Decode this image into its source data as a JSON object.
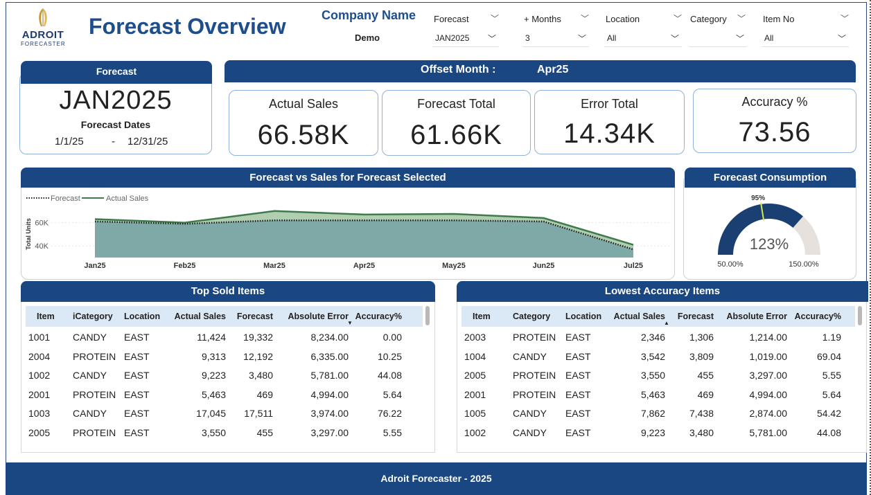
{
  "header": {
    "logo_text": "ADROIT",
    "logo_sub": "FORECASTER",
    "title": "Forecast Overview",
    "company_label": "Company Name",
    "company_value": "Demo"
  },
  "filters": [
    {
      "label": "Forecast",
      "value": "JAN2025"
    },
    {
      "label": "+ Months",
      "value": "3"
    },
    {
      "label": "Location",
      "value": "All"
    },
    {
      "label": "Category",
      "value": ""
    },
    {
      "label": "Item No",
      "value": "All"
    }
  ],
  "forecast_panel": {
    "title": "Forecast",
    "value": "JAN2025",
    "dates_label": "Forecast Dates",
    "start": "1/1/25",
    "sep": "-",
    "end": "12/31/25"
  },
  "offset": {
    "label": "Offset  Month :",
    "value": "Apr25"
  },
  "kpis": [
    {
      "title": "Actual Sales",
      "value": "66.58K"
    },
    {
      "title": "Forecast Total",
      "value": "61.66K"
    },
    {
      "title": "Error Total",
      "value": "14.34K"
    },
    {
      "title": "Accuracy %",
      "value": "73.56"
    }
  ],
  "chart_panel": {
    "title": "Forecast vs Sales for Forecast Selected"
  },
  "chart_data": {
    "type": "area",
    "x": [
      "Jan25",
      "Feb25",
      "Mar25",
      "Apr25",
      "May25",
      "Jun25",
      "Jul25"
    ],
    "series": [
      {
        "name": "Forecast",
        "values": [
          61000,
          59000,
          62000,
          62000,
          62000,
          61000,
          37000
        ]
      },
      {
        "name": "Actual Sales",
        "values": [
          63000,
          60000,
          70000,
          67000,
          67500,
          64000,
          41000
        ]
      }
    ],
    "ylabel": "Total Units",
    "yticks": [
      "40K",
      "60K"
    ],
    "ylim": [
      30000,
      80000
    ],
    "legend": "top-left",
    "colors": {
      "forecast": "#1a1a1a",
      "actual": "#3f7a4c",
      "fill": "#7fa9a6"
    }
  },
  "gauge": {
    "title": "Forecast Consumption",
    "target_label": "95%",
    "value_label": "123%",
    "min_label": "50.00%",
    "max_label": "150.00%",
    "min": 50,
    "max": 150,
    "value": 123,
    "target": 95,
    "colors": {
      "fill": "#1a3f73",
      "rest": "#e6e1dc",
      "target": "#d9e84a"
    }
  },
  "top_sold": {
    "title": "Top Sold Items",
    "columns": [
      "Item",
      "iCategory",
      "Location",
      "Actual Sales",
      "Forecast",
      "Absolute Error",
      "Accuracy%"
    ],
    "rows": [
      [
        "1001",
        "CANDY",
        "EAST",
        "11,424",
        "19,332",
        "8,234.00",
        "0.00"
      ],
      [
        "2004",
        "PROTEIN",
        "EAST",
        "9,313",
        "12,192",
        "6,335.00",
        "10.25"
      ],
      [
        "1002",
        "CANDY",
        "EAST",
        "9,223",
        "3,480",
        "5,781.00",
        "44.08"
      ],
      [
        "2001",
        "PROTEIN",
        "EAST",
        "5,463",
        "469",
        "4,994.00",
        "5.64"
      ],
      [
        "1003",
        "CANDY",
        "EAST",
        "17,045",
        "17,511",
        "3,974.00",
        "76.22"
      ],
      [
        "2005",
        "PROTEIN",
        "EAST",
        "3,550",
        "455",
        "3,297.00",
        "5.55"
      ]
    ]
  },
  "lowest_accuracy": {
    "title": "Lowest Accuracy Items",
    "columns": [
      "Item",
      "Category",
      "Location",
      "Actual Sales",
      "Forecast",
      "Absolute Error",
      "Accuracy%"
    ],
    "rows": [
      [
        "2003",
        "PROTEIN",
        "EAST",
        "2,346",
        "1,306",
        "1,214.00",
        "1.19"
      ],
      [
        "1004",
        "CANDY",
        "EAST",
        "3,542",
        "3,809",
        "1,019.00",
        "69.04"
      ],
      [
        "2005",
        "PROTEIN",
        "EAST",
        "3,550",
        "455",
        "3,297.00",
        "5.55"
      ],
      [
        "2001",
        "PROTEIN",
        "EAST",
        "5,463",
        "469",
        "4,994.00",
        "5.64"
      ],
      [
        "1005",
        "CANDY",
        "EAST",
        "7,862",
        "7,438",
        "2,874.00",
        "54.42"
      ],
      [
        "1002",
        "CANDY",
        "EAST",
        "9,223",
        "3,480",
        "5,781.00",
        "44.08"
      ]
    ]
  },
  "footer": {
    "text": "Adroit Forecaster - 2025"
  }
}
